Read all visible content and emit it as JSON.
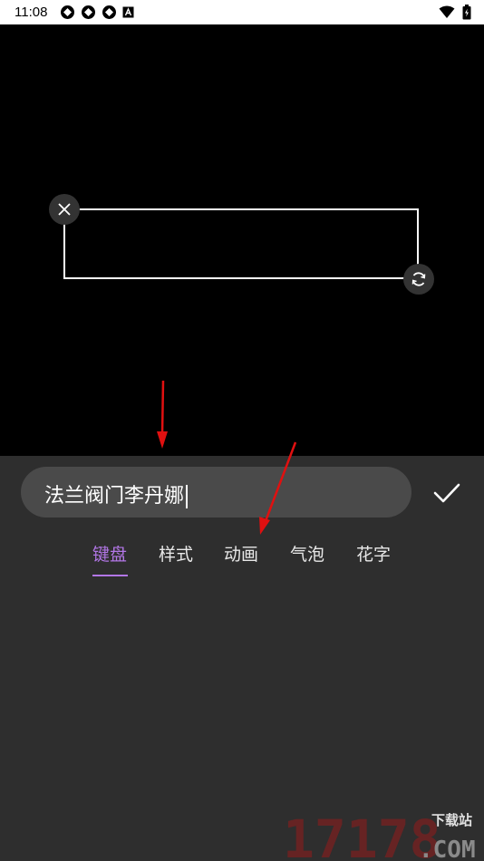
{
  "status_bar": {
    "time": "11:08"
  },
  "editor": {
    "text_value": "法兰阀门李丹娜"
  },
  "tabs": [
    {
      "label": "键盘",
      "active": true
    },
    {
      "label": "样式",
      "active": false
    },
    {
      "label": "动画",
      "active": false
    },
    {
      "label": "气泡",
      "active": false
    },
    {
      "label": "花字",
      "active": false
    }
  ],
  "watermark": {
    "number": "17178",
    "site": "下载站",
    "domain": ".COM"
  },
  "colors": {
    "accent": "#b276e6",
    "panel_bg": "#2e2e2e",
    "input_bg": "#4a4a4a",
    "annotation": "#e01010"
  },
  "icons": [
    "close-icon",
    "rotate-icon",
    "checkmark-icon",
    "wifi-icon",
    "battery-icon"
  ]
}
